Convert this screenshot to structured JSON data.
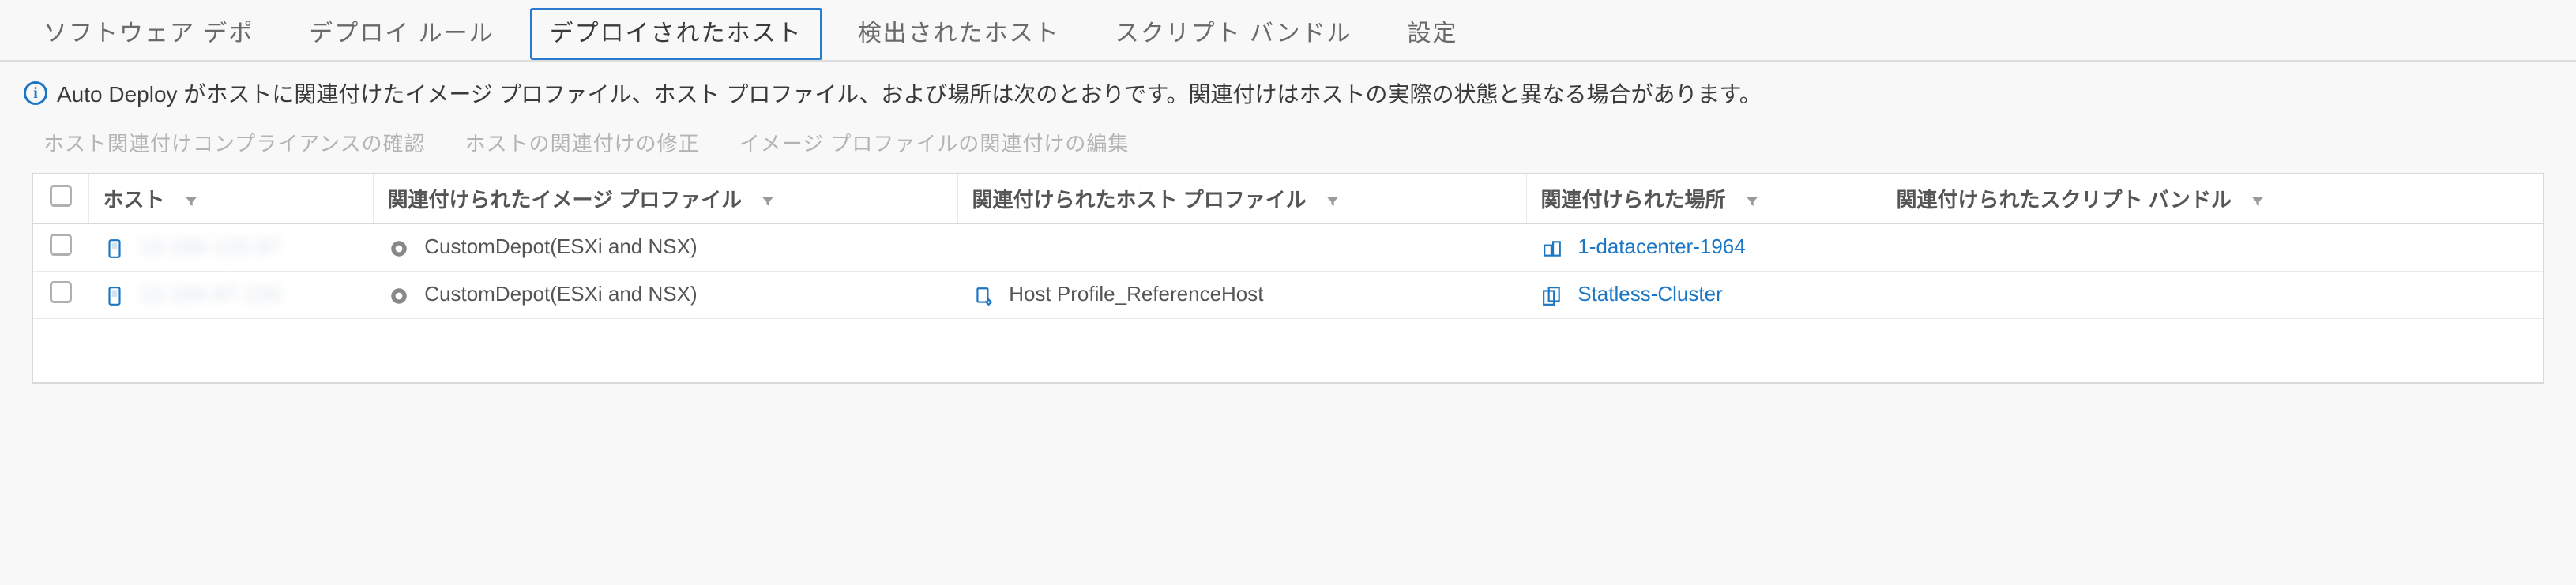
{
  "tabs": {
    "depot": "ソフトウェア デポ",
    "rules": "デプロイ ルール",
    "deployed": "デプロイされたホスト",
    "discovered": "検出されたホスト",
    "bundle": "スクリプト バンドル",
    "settings": "設定"
  },
  "info": {
    "text": "Auto Deploy がホストに関連付けたイメージ プロファイル、ホスト プロファイル、および場所は次のとおりです。関連付けはホストの実際の状態と異なる場合があります。"
  },
  "actions": {
    "compliance": "ホスト関連付けコンプライアンスの確認",
    "remediate": "ホストの関連付けの修正",
    "edit_img": "イメージ プロファイルの関連付けの編集"
  },
  "columns": {
    "host": "ホスト",
    "image_profile": "関連付けられたイメージ プロファイル",
    "host_profile": "関連付けられたホスト プロファイル",
    "location": "関連付けられた場所",
    "script_bundle": "関連付けられたスクリプト バンドル"
  },
  "rows": [
    {
      "host_masked": "10.184.120.97",
      "image_profile": "CustomDepot(ESXi and NSX)",
      "host_profile": "",
      "location": "1-datacenter-1964",
      "location_icon": "datacenter",
      "script_bundle": ""
    },
    {
      "host_masked": "10.184.97.220",
      "image_profile": "CustomDepot(ESXi and NSX)",
      "host_profile": "Host Profile_ReferenceHost",
      "location": "Statless-Cluster",
      "location_icon": "cluster",
      "script_bundle": ""
    }
  ]
}
